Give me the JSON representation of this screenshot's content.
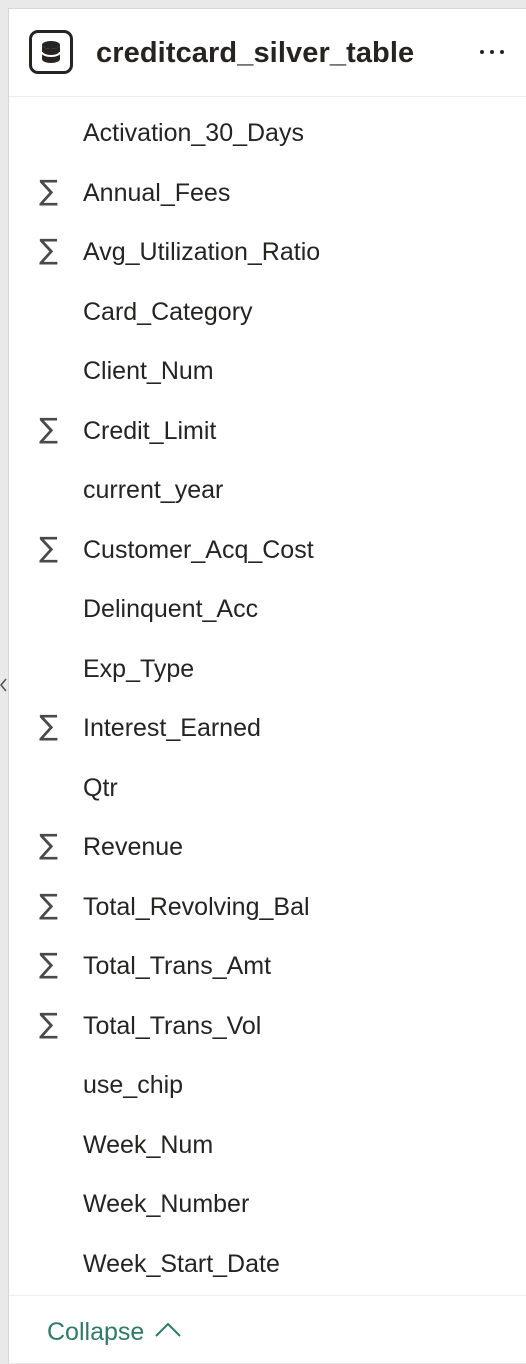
{
  "table": {
    "name": "creditcard_silver_table",
    "icon": "database-icon",
    "more_icon": "more-options-icon"
  },
  "fields": [
    {
      "label": "Activation_30_Days",
      "aggregatable": false
    },
    {
      "label": "Annual_Fees",
      "aggregatable": true
    },
    {
      "label": "Avg_Utilization_Ratio",
      "aggregatable": true
    },
    {
      "label": "Card_Category",
      "aggregatable": false
    },
    {
      "label": "Client_Num",
      "aggregatable": false
    },
    {
      "label": "Credit_Limit",
      "aggregatable": true
    },
    {
      "label": "current_year",
      "aggregatable": false
    },
    {
      "label": "Customer_Acq_Cost",
      "aggregatable": true
    },
    {
      "label": "Delinquent_Acc",
      "aggregatable": false
    },
    {
      "label": "Exp_Type",
      "aggregatable": false
    },
    {
      "label": "Interest_Earned",
      "aggregatable": true
    },
    {
      "label": "Qtr",
      "aggregatable": false
    },
    {
      "label": "Revenue",
      "aggregatable": true
    },
    {
      "label": "Total_Revolving_Bal",
      "aggregatable": true
    },
    {
      "label": "Total_Trans_Amt",
      "aggregatable": true
    },
    {
      "label": "Total_Trans_Vol",
      "aggregatable": true
    },
    {
      "label": "use_chip",
      "aggregatable": false
    },
    {
      "label": "Week_Num",
      "aggregatable": false
    },
    {
      "label": "Week_Number",
      "aggregatable": false
    },
    {
      "label": "Week_Start_Date",
      "aggregatable": false
    }
  ],
  "sigma_symbol": "∑",
  "footer": {
    "collapse_label": "Collapse",
    "icon": "chevron-up-icon"
  },
  "colors": {
    "accent": "#2f7a6b",
    "text": "#252423",
    "icon": "#4a4a4a"
  }
}
